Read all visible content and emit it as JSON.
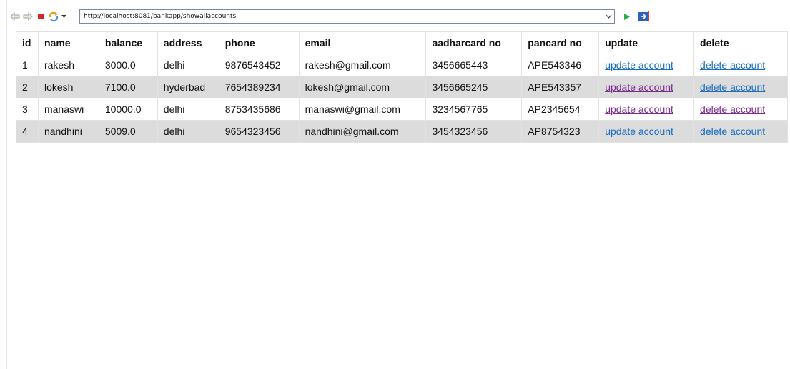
{
  "toolbar": {
    "back_icon": "back-arrow-icon",
    "forward_icon": "forward-arrow-icon",
    "stop_icon": "stop-icon",
    "refresh_icon": "refresh-icon",
    "url": "http://localhost:8081/bankapp/showallaccounts",
    "go_icon": "go-play-icon",
    "external_icon": "open-external-icon"
  },
  "table": {
    "headers": [
      "id",
      "name",
      "balance",
      "address",
      "phone",
      "email",
      "aadharcard no",
      "pancard no",
      "update",
      "delete"
    ],
    "rows": [
      {
        "id": "1",
        "name": "rakesh",
        "balance": "3000.0",
        "address": "delhi",
        "phone": "9876543452",
        "email": "rakesh@gmail.com",
        "aadhar": "3456665443",
        "pan": "APE543346",
        "update": "update account",
        "delete": "delete account"
      },
      {
        "id": "2",
        "name": "lokesh",
        "balance": "7100.0",
        "address": "hyderbad",
        "phone": "7654389234",
        "email": "lokesh@gmail.com",
        "aadhar": "3456665245",
        "pan": "APE543357",
        "update": "update account",
        "delete": "delete account"
      },
      {
        "id": "3",
        "name": "manaswi",
        "balance": "10000.0",
        "address": "delhi",
        "phone": "8753435686",
        "email": "manaswi@gmail.com",
        "aadhar": "3234567765",
        "pan": "AP2345654",
        "update": "update account",
        "delete": "delete account"
      },
      {
        "id": "4",
        "name": "nandhini",
        "balance": "5009.0",
        "address": "delhi",
        "phone": "9654323456",
        "email": "nandhini@gmail.com",
        "aadhar": "3454323456",
        "pan": "AP8754323",
        "update": "update account",
        "delete": "delete account"
      }
    ]
  },
  "colors": {
    "link": "#1a6dbf",
    "visited_link": "#7b2a8e",
    "stripe": "#dcdcdc"
  }
}
